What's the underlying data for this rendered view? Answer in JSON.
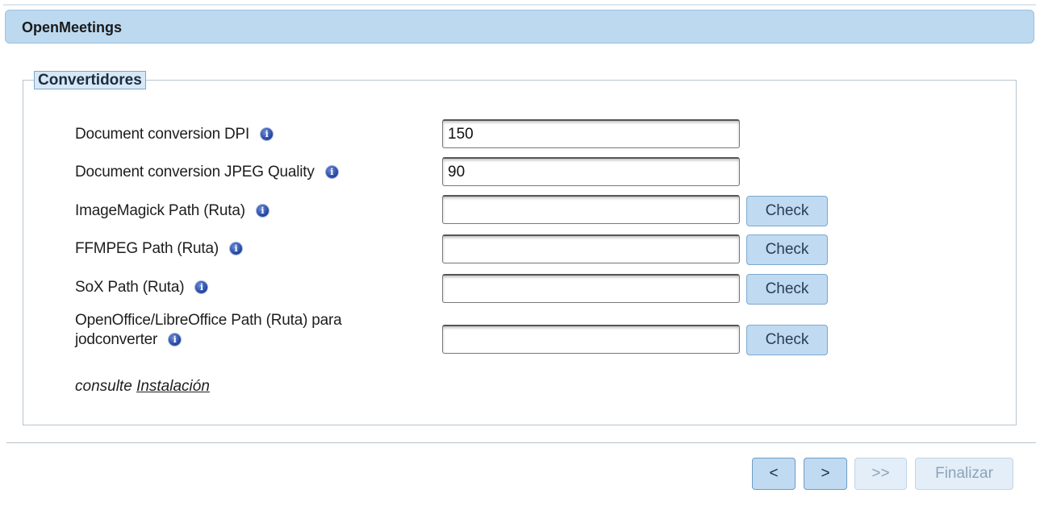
{
  "header": {
    "title": "OpenMeetings"
  },
  "section": {
    "legend": "Convertidores"
  },
  "fields": [
    {
      "label": "Document conversion DPI",
      "value": "150",
      "check": null
    },
    {
      "label": "Document conversion JPEG Quality",
      "value": "90",
      "check": null
    },
    {
      "label": "ImageMagick Path (Ruta)",
      "value": "",
      "check": "Check"
    },
    {
      "label": "FFMPEG Path (Ruta)",
      "value": "",
      "check": "Check"
    },
    {
      "label": "SoX Path (Ruta)",
      "value": "",
      "check": "Check"
    },
    {
      "label_line1": "OpenOffice/LibreOffice Path (Ruta) para",
      "label_line2": "jodconverter",
      "value": "",
      "check": "Check"
    }
  ],
  "consult": {
    "prefix": "consulte",
    "link": "Instalación"
  },
  "nav": {
    "prev": "<",
    "next": ">",
    "last": ">>",
    "finish": "Finalizar"
  },
  "icons": {
    "info": "info-icon"
  },
  "colors": {
    "header_bg": "#bcd9f0",
    "button_bg": "#bfdaf1",
    "legend_bg": "#d7e7f5",
    "disabled_text": "#8ea3b8"
  }
}
